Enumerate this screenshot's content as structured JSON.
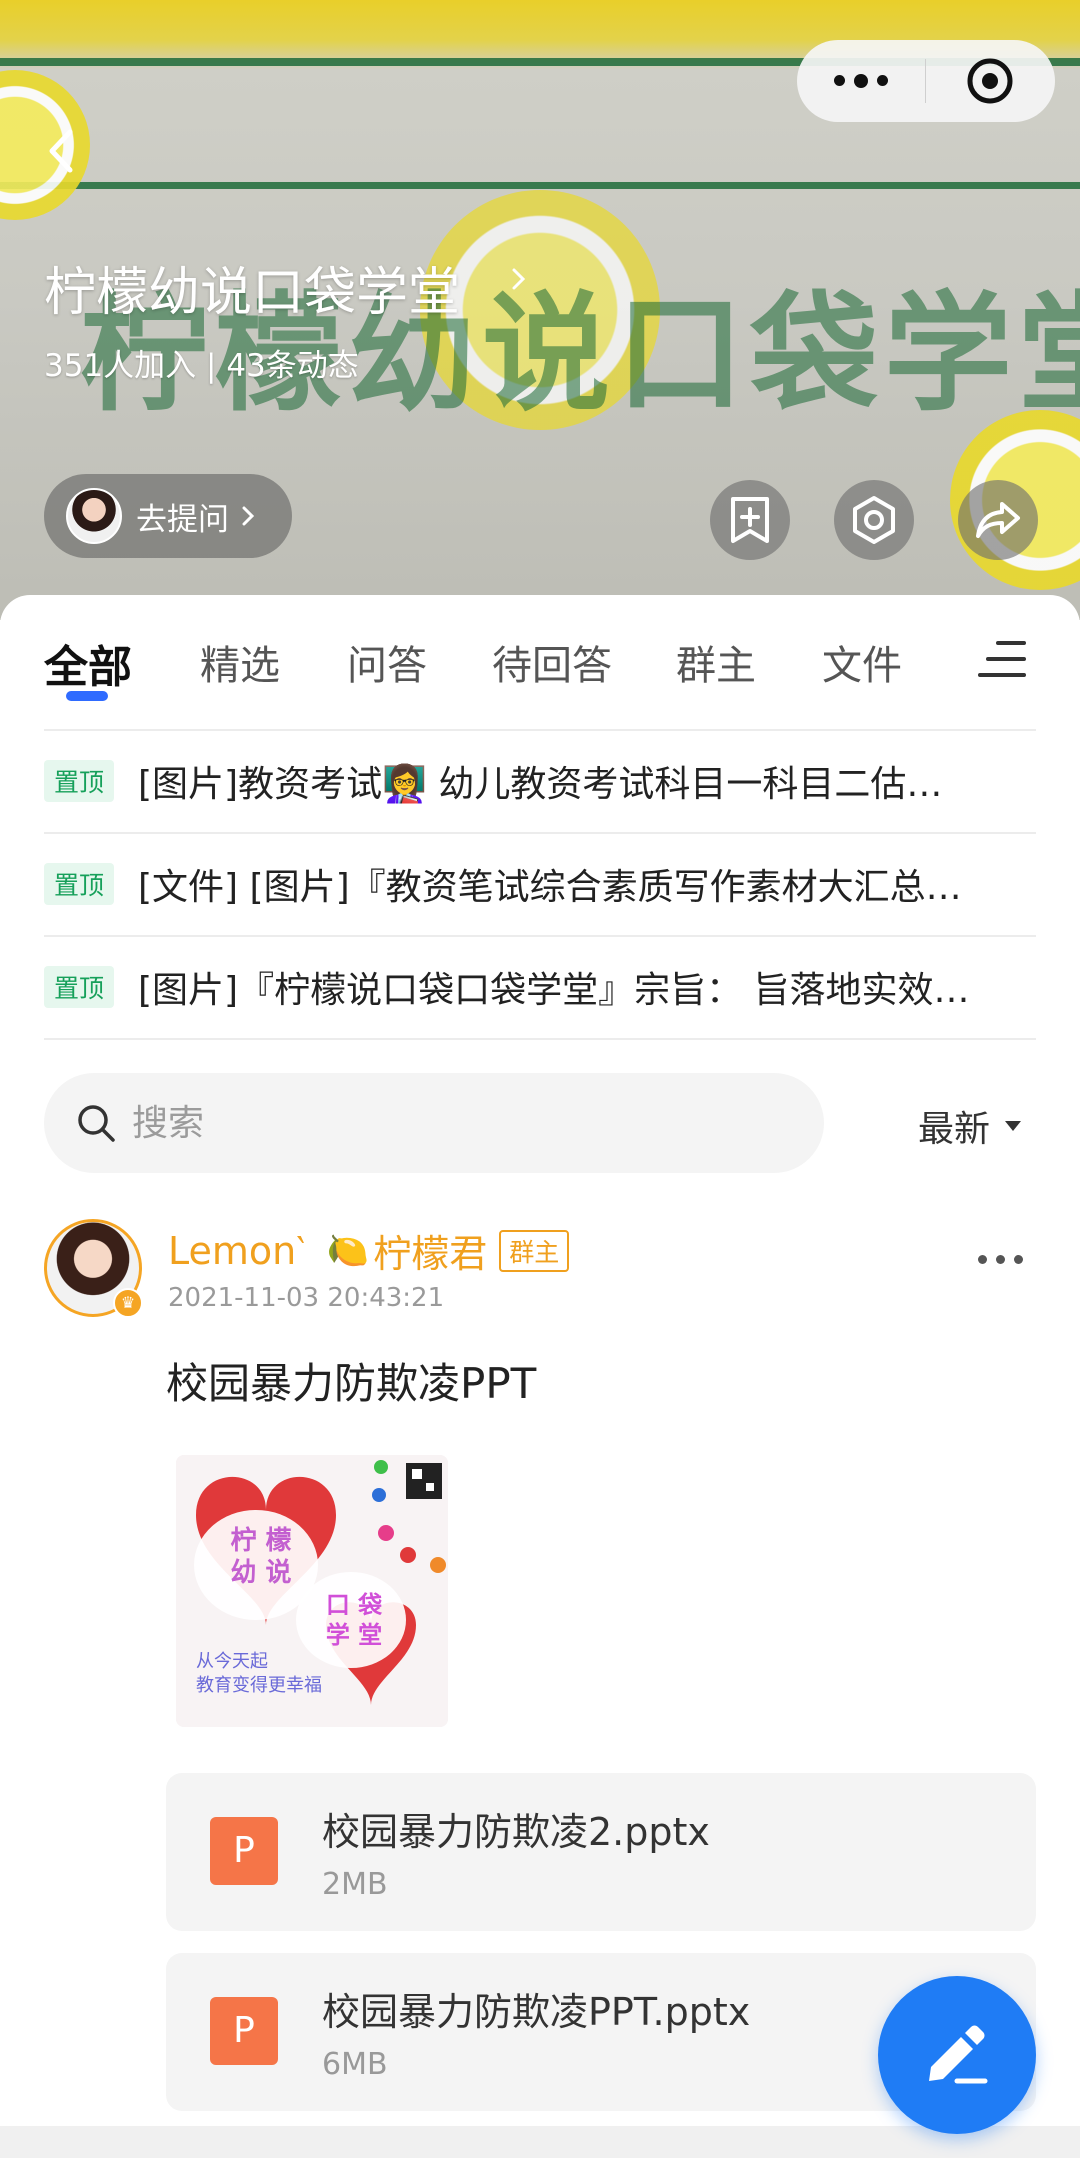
{
  "header": {
    "banner_text": "柠檬幼说口袋学堂",
    "title": "柠檬幼说口袋学堂",
    "meta": "351人加入 | 43条动态",
    "ask_label": "去提问"
  },
  "tabs": [
    {
      "label": "全部",
      "active": true
    },
    {
      "label": "精选"
    },
    {
      "label": "问答"
    },
    {
      "label": "待回答"
    },
    {
      "label": "群主"
    },
    {
      "label": "文件"
    }
  ],
  "pinned": [
    {
      "badge": "置顶",
      "text": "[图片]教资考试👩‍🏫 幼儿教资考试科目一科目二估…"
    },
    {
      "badge": "置顶",
      "text": "[文件] [图片]『教资笔试综合素质写作素材大汇总…"
    },
    {
      "badge": "置顶",
      "text": "[图片]『柠檬说口袋口袋学堂』宗旨：  旨落地实效…"
    }
  ],
  "search": {
    "placeholder": "搜索"
  },
  "sort": {
    "label": "最新"
  },
  "post": {
    "author": "Lemon‵",
    "emoji": "🍋",
    "nickname": "柠檬君",
    "badge": "群主",
    "time": "2021-11-03 20:43:21",
    "text": "校园暴力防欺凌PPT",
    "image_text": {
      "line1": "柠 檬",
      "line2": "幼 说",
      "line3": "口 袋",
      "line4": "学 堂",
      "caption1": "从今天起",
      "caption2": "教育变得更幸福"
    },
    "files": [
      {
        "icon": "P",
        "name": "校园暴力防欺凌2.pptx",
        "size": "2MB"
      },
      {
        "icon": "P",
        "name": "校园暴力防欺凌PPT.pptx",
        "size": "6MB"
      }
    ]
  },
  "colors": {
    "accent": "#2f6bff",
    "fab": "#1f7cf5",
    "author": "#f0a01e",
    "pin": "#16a05a"
  }
}
